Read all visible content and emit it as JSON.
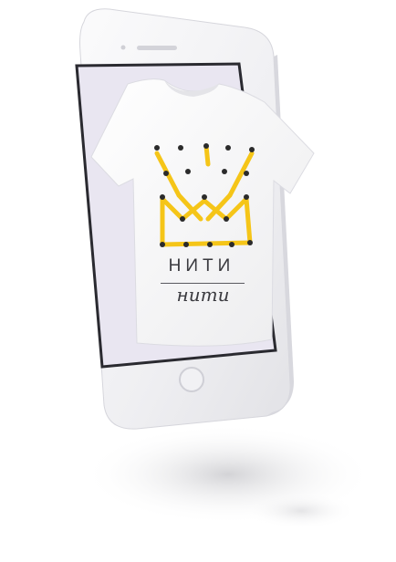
{
  "brand": {
    "name_top": "НИТИ",
    "name_bottom": "нити"
  },
  "colors": {
    "crown_yellow": "#f5c518",
    "dot_black": "#2b2b2b",
    "phone_body": "#f3f3f5",
    "screen_bg": "#e6e3ef",
    "screen_bezel": "#2a2a30"
  },
  "icons": [
    "phone-speaker-icon",
    "home-button-icon",
    "front-camera-icon",
    "crown-logo-icon"
  ]
}
